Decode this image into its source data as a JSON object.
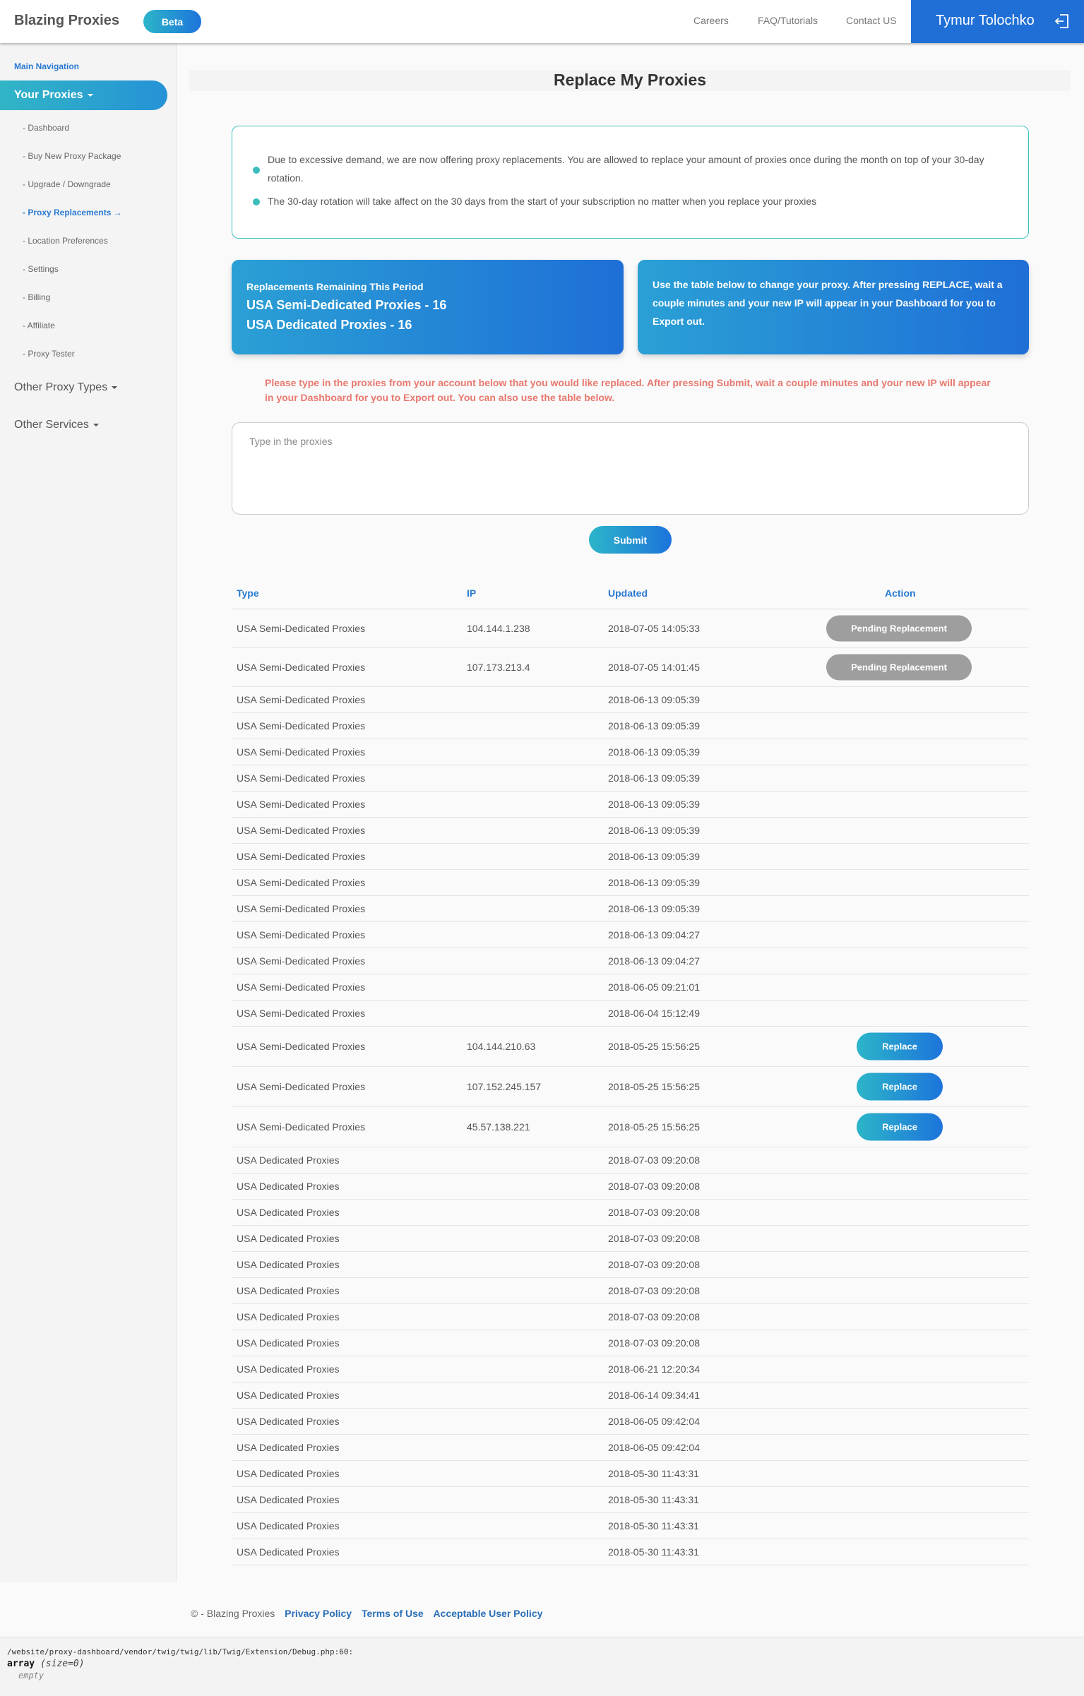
{
  "header": {
    "brand": "Blazing Proxies",
    "beta": "Beta",
    "links": [
      "Careers",
      "FAQ/Tutorials",
      "Contact US"
    ],
    "user": "Tymur Tolochko",
    "logout_icon": "logout-icon"
  },
  "sidebar": {
    "section": "Main Navigation",
    "your_proxies": "Your Proxies",
    "items": [
      {
        "label": "- Dashboard"
      },
      {
        "label": "- Buy New Proxy Package"
      },
      {
        "label": "- Upgrade / Downgrade"
      },
      {
        "label": "- Proxy Replacements →"
      },
      {
        "label": "- Location Preferences"
      },
      {
        "label": "- Settings"
      },
      {
        "label": "- Billing"
      },
      {
        "label": "- Affiliate"
      },
      {
        "label": "- Proxy Tester"
      }
    ],
    "other_proxy_types": "Other Proxy Types",
    "other_services": "Other Services"
  },
  "page": {
    "title": "Replace My Proxies",
    "notices": [
      "Due to excessive demand, we are now offering proxy replacements. You are allowed to replace your amount of proxies once during the month on top of your 30-day rotation.",
      "The 30-day rotation will take affect on the 30 days from the start of your subscription no matter when you replace your proxies"
    ],
    "remaining_label": "Replacements Remaining This Period",
    "remaining_semi": "USA Semi-Dedicated Proxies - 16",
    "remaining_dedicated": "USA Dedicated Proxies - 16",
    "table_help": "Use the table below to change your proxy. After pressing REPLACE, wait a couple minutes and your new IP will appear in your Dashboard for you to Export out.",
    "warning": "Please type in the proxies from your account below that you would like replaced. After pressing Submit, wait a couple minutes and your new IP will appear in your Dashboard for you to Export out. You can also use the table below.",
    "input_placeholder": "Type in the proxies",
    "submit": "Submit"
  },
  "table": {
    "headers": {
      "type": "Type",
      "ip": "IP",
      "updated": "Updated",
      "action": "Action"
    },
    "rows": [
      {
        "type": "USA Semi-Dedicated Proxies",
        "ip": "104.144.1.238",
        "updated": "2018-07-05 14:05:33",
        "action": "Pending Replacement"
      },
      {
        "type": "USA Semi-Dedicated Proxies",
        "ip": "107.173.213.4",
        "updated": "2018-07-05 14:01:45",
        "action": "Pending Replacement"
      },
      {
        "type": "USA Semi-Dedicated Proxies",
        "ip": "",
        "updated": "2018-06-13 09:05:39",
        "action": ""
      },
      {
        "type": "USA Semi-Dedicated Proxies",
        "ip": "",
        "updated": "2018-06-13 09:05:39",
        "action": ""
      },
      {
        "type": "USA Semi-Dedicated Proxies",
        "ip": "",
        "updated": "2018-06-13 09:05:39",
        "action": ""
      },
      {
        "type": "USA Semi-Dedicated Proxies",
        "ip": "",
        "updated": "2018-06-13 09:05:39",
        "action": ""
      },
      {
        "type": "USA Semi-Dedicated Proxies",
        "ip": "",
        "updated": "2018-06-13 09:05:39",
        "action": ""
      },
      {
        "type": "USA Semi-Dedicated Proxies",
        "ip": "",
        "updated": "2018-06-13 09:05:39",
        "action": ""
      },
      {
        "type": "USA Semi-Dedicated Proxies",
        "ip": "",
        "updated": "2018-06-13 09:05:39",
        "action": ""
      },
      {
        "type": "USA Semi-Dedicated Proxies",
        "ip": "",
        "updated": "2018-06-13 09:05:39",
        "action": ""
      },
      {
        "type": "USA Semi-Dedicated Proxies",
        "ip": "",
        "updated": "2018-06-13 09:05:39",
        "action": ""
      },
      {
        "type": "USA Semi-Dedicated Proxies",
        "ip": "",
        "updated": "2018-06-13 09:04:27",
        "action": ""
      },
      {
        "type": "USA Semi-Dedicated Proxies",
        "ip": "",
        "updated": "2018-06-13 09:04:27",
        "action": ""
      },
      {
        "type": "USA Semi-Dedicated Proxies",
        "ip": "",
        "updated": "2018-06-05 09:21:01",
        "action": ""
      },
      {
        "type": "USA Semi-Dedicated Proxies",
        "ip": "",
        "updated": "2018-06-04 15:12:49",
        "action": ""
      },
      {
        "type": "USA Semi-Dedicated Proxies",
        "ip": "104.144.210.63",
        "updated": "2018-05-25 15:56:25",
        "action": "Replace"
      },
      {
        "type": "USA Semi-Dedicated Proxies",
        "ip": "107.152.245.157",
        "updated": "2018-05-25 15:56:25",
        "action": "Replace"
      },
      {
        "type": "USA Semi-Dedicated Proxies",
        "ip": "45.57.138.221",
        "updated": "2018-05-25 15:56:25",
        "action": "Replace"
      },
      {
        "type": "USA Dedicated Proxies",
        "ip": "",
        "updated": "2018-07-03 09:20:08",
        "action": ""
      },
      {
        "type": "USA Dedicated Proxies",
        "ip": "",
        "updated": "2018-07-03 09:20:08",
        "action": ""
      },
      {
        "type": "USA Dedicated Proxies",
        "ip": "",
        "updated": "2018-07-03 09:20:08",
        "action": ""
      },
      {
        "type": "USA Dedicated Proxies",
        "ip": "",
        "updated": "2018-07-03 09:20:08",
        "action": ""
      },
      {
        "type": "USA Dedicated Proxies",
        "ip": "",
        "updated": "2018-07-03 09:20:08",
        "action": ""
      },
      {
        "type": "USA Dedicated Proxies",
        "ip": "",
        "updated": "2018-07-03 09:20:08",
        "action": ""
      },
      {
        "type": "USA Dedicated Proxies",
        "ip": "",
        "updated": "2018-07-03 09:20:08",
        "action": ""
      },
      {
        "type": "USA Dedicated Proxies",
        "ip": "",
        "updated": "2018-07-03 09:20:08",
        "action": ""
      },
      {
        "type": "USA Dedicated Proxies",
        "ip": "",
        "updated": "2018-06-21 12:20:34",
        "action": ""
      },
      {
        "type": "USA Dedicated Proxies",
        "ip": "",
        "updated": "2018-06-14 09:34:41",
        "action": ""
      },
      {
        "type": "USA Dedicated Proxies",
        "ip": "",
        "updated": "2018-06-05 09:42:04",
        "action": ""
      },
      {
        "type": "USA Dedicated Proxies",
        "ip": "",
        "updated": "2018-06-05 09:42:04",
        "action": ""
      },
      {
        "type": "USA Dedicated Proxies",
        "ip": "",
        "updated": "2018-05-30 11:43:31",
        "action": ""
      },
      {
        "type": "USA Dedicated Proxies",
        "ip": "",
        "updated": "2018-05-30 11:43:31",
        "action": ""
      },
      {
        "type": "USA Dedicated Proxies",
        "ip": "",
        "updated": "2018-05-30 11:43:31",
        "action": ""
      },
      {
        "type": "USA Dedicated Proxies",
        "ip": "",
        "updated": "2018-05-30 11:43:31",
        "action": ""
      }
    ]
  },
  "footer": {
    "copyright": "© - Blazing Proxies",
    "links": [
      "Privacy Policy",
      "Terms of Use",
      "Acceptable User Policy"
    ]
  },
  "debug": {
    "path": "/website/proxy-dashboard/vendor/twig/twig/lib/Twig/Extension/Debug.php:60:",
    "array": "array",
    "size": "(size=0)",
    "empty": "empty"
  },
  "colors": {
    "accent": "#1f6fd6",
    "teal": "#2cb5c9",
    "warning": "#e8786e",
    "pending": "#9e9e9e"
  }
}
